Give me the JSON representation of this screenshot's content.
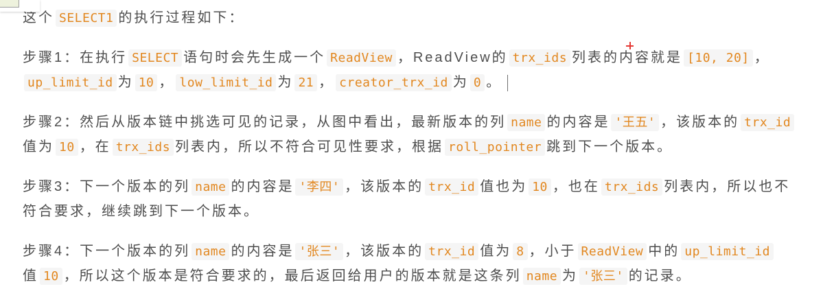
{
  "article": {
    "paragraphs": [
      [
        [
          "这个",
          "SELECT1",
          "的执行过程如下："
        ]
      ],
      [
        [
          "步骤1：在执行",
          "SELECT",
          "语句时会先生成一个",
          "ReadView",
          "，ReadView的",
          "trx_ids",
          "列表的内容就是",
          "[10, 20]",
          "，"
        ],
        [
          "up_limit_id",
          "为",
          "10",
          "，",
          "low_limit_id",
          "为",
          "21",
          "，",
          "creator_trx_id",
          "为",
          "0",
          "。"
        ]
      ],
      [
        [
          "步骤2：然后从版本链中挑选可见的记录，从图中看出，最新版本的列",
          "name",
          "的内容是",
          "'王五'",
          "，该版本的",
          "trx_id"
        ],
        [
          "值为",
          "10",
          "，在",
          "trx_ids",
          "列表内，所以不符合可见性要求，根据",
          "roll_pointer",
          "跳到下一个版本。"
        ]
      ],
      [
        [
          "步骤3：下一个版本的列",
          "name",
          "的内容是",
          "'李四'",
          "，该版本的",
          "trx_id",
          "值也为",
          "10",
          "，也在",
          "trx_ids",
          "列表内，所以也不"
        ],
        [
          "符合要求，继续跳到下一个版本。"
        ]
      ],
      [
        [
          "步骤4：下一个版本的列",
          "name",
          "的内容是",
          "'张三'",
          "，该版本的",
          "trx_id",
          "值为",
          "8",
          "，小于",
          "ReadView",
          "中的",
          "up_limit_id"
        ],
        [
          "值",
          "10",
          "，所以这个版本是符合要求的，最后返回给用户的版本就是这条列",
          "name",
          "为",
          "'张三'",
          "的记录。"
        ]
      ]
    ]
  },
  "colors": {
    "text": "#4d4d4d",
    "code_text": "#e2871f",
    "code_background": "#f5f5f5",
    "marker": "#e53935"
  }
}
